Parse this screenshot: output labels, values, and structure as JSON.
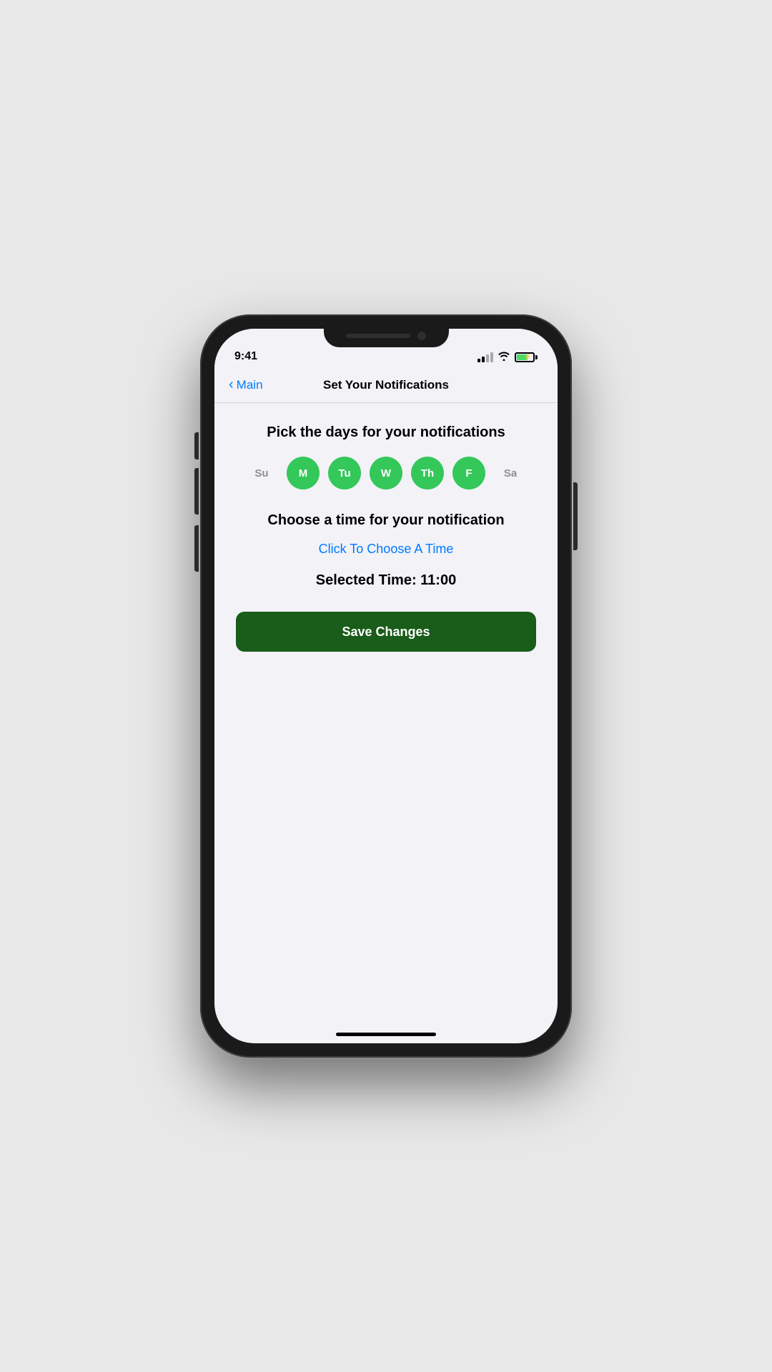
{
  "status_bar": {
    "time": "9:41"
  },
  "nav": {
    "back_label": "Main",
    "title": "Set Your Notifications"
  },
  "days_section": {
    "title": "Pick the days for your notifications",
    "days": [
      {
        "label": "Su",
        "active": false
      },
      {
        "label": "M",
        "active": true
      },
      {
        "label": "Tu",
        "active": true
      },
      {
        "label": "W",
        "active": true
      },
      {
        "label": "Th",
        "active": true
      },
      {
        "label": "F",
        "active": true
      },
      {
        "label": "Sa",
        "active": false
      }
    ]
  },
  "time_section": {
    "title": "Choose a time for your notification",
    "choose_link": "Click To Choose A Time",
    "selected_label": "Selected Time: 11:00"
  },
  "actions": {
    "save_label": "Save Changes"
  }
}
